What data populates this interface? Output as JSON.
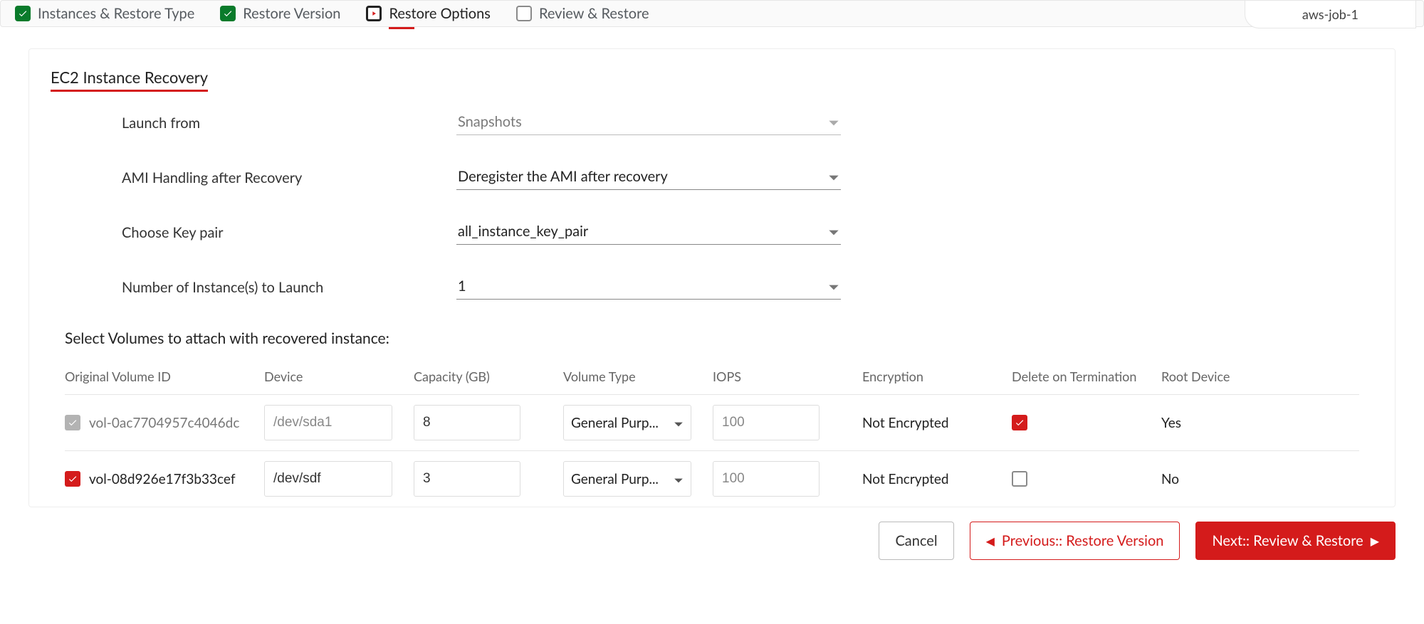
{
  "job_name": "aws-job-1",
  "steps": {
    "s1": {
      "label": "Instances & Restore Type",
      "state": "done"
    },
    "s2": {
      "label": "Restore Version",
      "state": "done"
    },
    "s3": {
      "label": "Restore Options",
      "state": "active"
    },
    "s4": {
      "label": "Review & Restore",
      "state": "pending"
    }
  },
  "card_title": "EC2 Instance Recovery",
  "form": {
    "launch_from": {
      "label": "Launch from",
      "value": "Snapshots",
      "disabled": true
    },
    "ami_handling": {
      "label": "AMI Handling after Recovery",
      "value": "Deregister the AMI after recovery"
    },
    "key_pair": {
      "label": "Choose Key pair",
      "value": "all_instance_key_pair"
    },
    "num_instances": {
      "label": "Number of Instance(s) to Launch",
      "value": "1"
    }
  },
  "volumes_heading": "Select Volumes to attach with recovered instance:",
  "volumes_columns": {
    "c1": "Original Volume ID",
    "c2": "Device",
    "c3": "Capacity (GB)",
    "c4": "Volume Type",
    "c5": "IOPS",
    "c6": "Encryption",
    "c7": "Delete on Termination",
    "c8": "Root Device"
  },
  "volumes": [
    {
      "selected": "locked",
      "volume_id": "vol-0ac7704957c4046dc",
      "device": "/dev/sda1",
      "capacity": "8",
      "volume_type": "General Purp...",
      "iops": "100",
      "encryption": "Not Encrypted",
      "delete_on_term": true,
      "root_device": "Yes"
    },
    {
      "selected": true,
      "volume_id": "vol-08d926e17f3b33cef",
      "device": "/dev/sdf",
      "capacity": "3",
      "volume_type": "General Purp...",
      "iops": "100",
      "encryption": "Not Encrypted",
      "delete_on_term": false,
      "root_device": "No"
    }
  ],
  "footer": {
    "cancel": "Cancel",
    "prev": "Previous:: Restore Version",
    "next": "Next:: Review & Restore"
  }
}
